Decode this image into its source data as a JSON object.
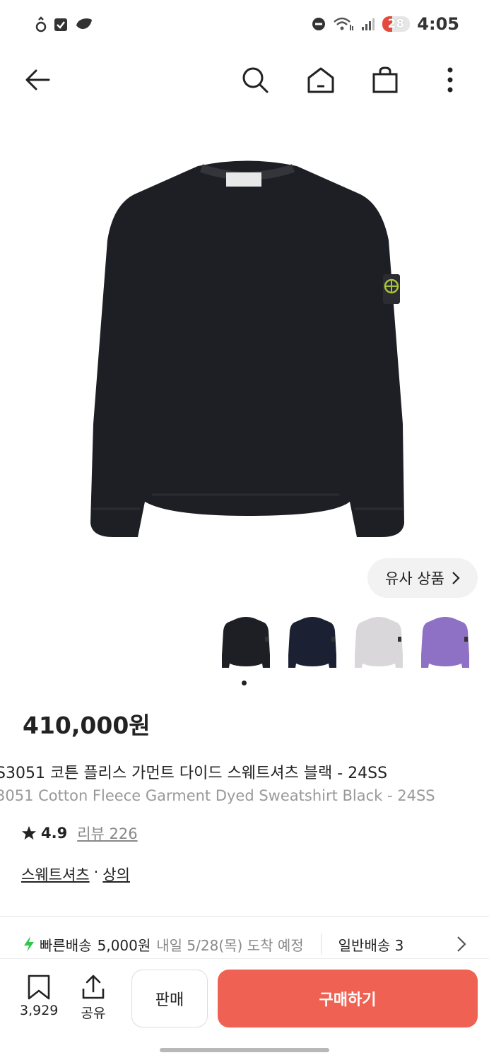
{
  "status_bar": {
    "time": "4:05",
    "battery": "28"
  },
  "app_bar": {
    "icons": [
      "back-arrow-icon",
      "search-icon",
      "home-icon",
      "shopping-bag-icon",
      "more-vertical-icon"
    ]
  },
  "gallery": {
    "similar_label": "유사 상품",
    "thumbnail_colors": [
      "#1d1f24",
      "#1b2133",
      "#d9d7da",
      "#8e70c4"
    ],
    "active_index": 0
  },
  "product": {
    "price": "410,000원",
    "title_ko": "S3051 코튼 플리스 가먼트 다이드 스웨트셔츠 블랙 - 24SS",
    "title_en": "3051 Cotton Fleece Garment Dyed Sweatshirt Black - 24SS",
    "rating": "4.9",
    "reviews": "리뷰 226",
    "category": [
      "스웨트셔츠",
      "상의"
    ],
    "category_sep": "·"
  },
  "shipping": {
    "fast_label": "빠른배송",
    "fast_fee": "5,000원",
    "fast_date": "내일 5/28(목) 도착 예정",
    "normal_label": "일반배송 3"
  },
  "bottom_bar": {
    "wish_count": "3,929",
    "share_label": "공유",
    "sell_label": "판매",
    "buy_label": "구매하기"
  },
  "colors": {
    "accent": "#ef6253",
    "lightning": "#2ec94c",
    "shirt": "#1d1f24"
  }
}
